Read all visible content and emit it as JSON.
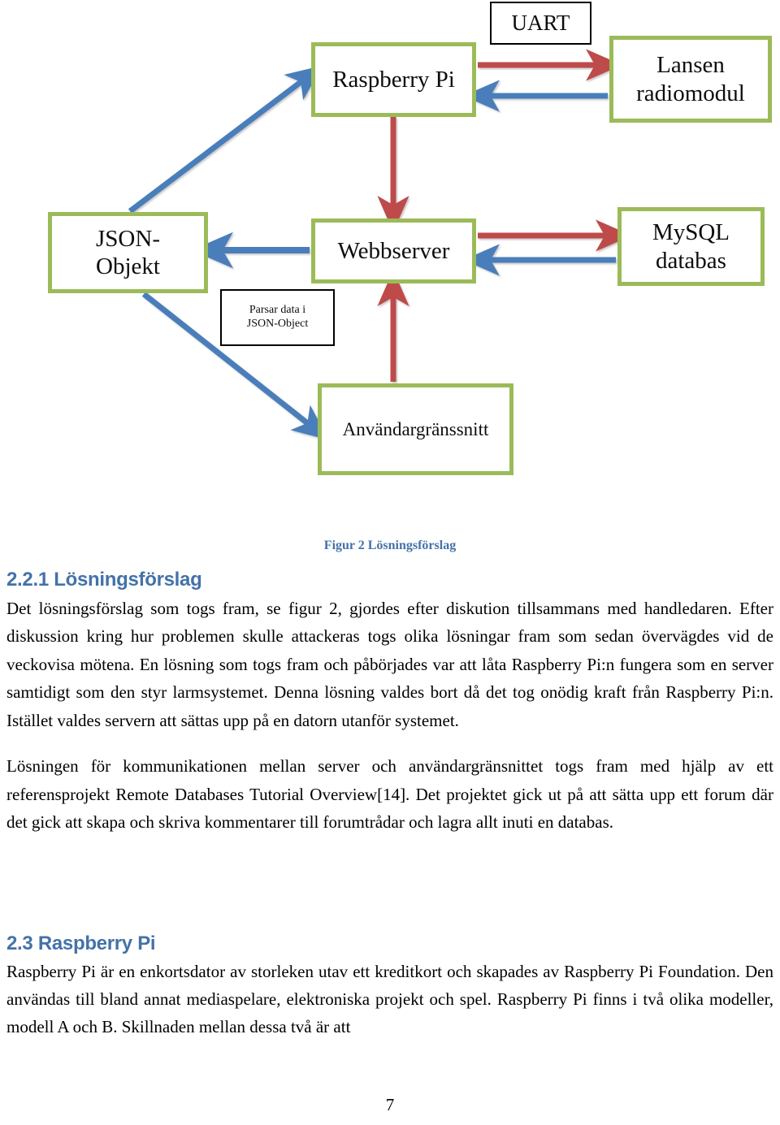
{
  "figure": {
    "caption": "Figur 2 Lösningsförslag",
    "caption_color": "#4472A8",
    "node_border_color": "#9BBB59",
    "arrow_red": "#BE4B48",
    "arrow_blue": "#4A7EBB",
    "nodes": {
      "raspberry_pi": "Raspberry Pi",
      "lansen_line1": "Lansen",
      "lansen_line2": "radiomodul",
      "json_line1": "JSON-",
      "json_line2": "Objekt",
      "webbserver": "Webbserver",
      "mysql_line1": "MySQL",
      "mysql_line2": "databas",
      "anvandargranssnitt": "Användargränssnitt"
    },
    "notes": {
      "uart": "UART",
      "parsar_line1": "Parsar data i",
      "parsar_line2": "JSON-Object"
    }
  },
  "sections": {
    "losningsforslag": {
      "heading": "2.2.1 Lösningsförslag",
      "paragraph_1": "Det lösningsförslag som togs fram, se figur 2, gjordes efter diskution tillsammans med handledaren. Efter diskussion kring hur problemen skulle attackeras togs olika lösningar fram som sedan övervägdes vid de veckovisa mötena. En lösning som togs fram och påbörjades var att låta Raspberry Pi:n fungera som en server samtidigt som den styr larmsystemet. Denna lösning valdes bort då det tog onödig kraft från Raspberry Pi:n. Istället valdes servern att sättas upp på en datorn utanför systemet.",
      "paragraph_2": "Lösningen för kommunikationen mellan server och användargränsnittet togs fram med hjälp av ett referensprojekt Remote Databases Tutorial Overview[14]. Det projektet gick ut på att sätta upp ett forum där det gick att skapa och skriva kommentarer till forumtrådar och lagra allt inuti en databas."
    },
    "raspberry_pi": {
      "heading": "2.3 Raspberry Pi",
      "paragraph_1": "Raspberry Pi är en enkortsdator av storleken utav ett kreditkort och skapades av Raspberry Pi Foundation. Den användas till bland annat mediaspelare, elektroniska projekt och spel. Raspberry Pi finns i två olika modeller, modell A och B. Skillnaden mellan dessa två är att"
    }
  },
  "footer": {
    "page_number": "7"
  }
}
